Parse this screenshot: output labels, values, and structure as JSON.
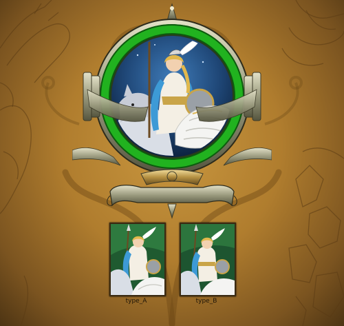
{
  "scene": {
    "background_color": "#b07d2e",
    "ring_color": "#21b21f",
    "metal_color": "#9a9a7e",
    "frame_icon": "hero-portrait-frame-icon",
    "hero_icon": "winged-valkyrie-rider-icon"
  },
  "variants": [
    {
      "label": "type_A",
      "icon": "valkyrie-portrait-a-icon"
    },
    {
      "label": "type_B",
      "icon": "valkyrie-portrait-b-icon"
    }
  ]
}
